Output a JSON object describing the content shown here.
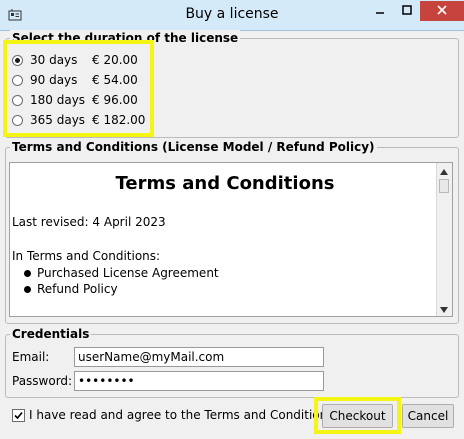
{
  "window": {
    "title": "Buy a license",
    "icons": {
      "app": "license-card-icon",
      "minimize": "minimize-icon",
      "maximize": "maximize-icon",
      "close": "close-icon"
    },
    "close_color": "#c7443e"
  },
  "duration": {
    "title": "Select the duration of the license",
    "selected_index": 0,
    "options": [
      {
        "days": "30 days",
        "price": "€ 20.00"
      },
      {
        "days": "90 days",
        "price": "€ 54.00"
      },
      {
        "days": "180 days",
        "price": "€ 96.00"
      },
      {
        "days": "365 days",
        "price": "€ 182.00"
      }
    ]
  },
  "terms": {
    "title": "Terms and Conditions  (License Model / Refund Policy)",
    "heading": "Terms and Conditions",
    "revised": "Last revised: 4 April 2023",
    "intro": "In Terms and Conditions:",
    "bullets": [
      "Purchased License Agreement",
      "Refund Policy"
    ]
  },
  "credentials": {
    "title": "Credentials",
    "email_label": "Email:",
    "email_value": "userName@myMail.com",
    "password_label": "Password:",
    "password_value": "••••••••"
  },
  "footer": {
    "agree_label": "I have read and agree to the Terms and Conditions.",
    "agree_checked": true,
    "checkout_label": "Checkout",
    "cancel_label": "Cancel"
  },
  "highlight_color": "#f5f515"
}
